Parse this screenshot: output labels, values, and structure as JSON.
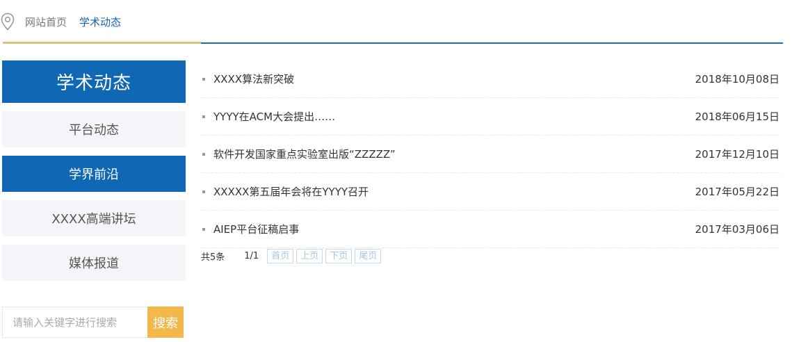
{
  "breadcrumb": {
    "home": "网站首页",
    "current": "学术动态"
  },
  "sidebar": {
    "title": "学术动态",
    "items": [
      {
        "label": "平台动态",
        "active": false
      },
      {
        "label": "学界前沿",
        "active": true
      },
      {
        "label": "XXXX高端讲坛",
        "active": false
      },
      {
        "label": "媒体报道",
        "active": false
      }
    ]
  },
  "search": {
    "placeholder": "请输入关键字进行搜索",
    "button": "搜索"
  },
  "news": [
    {
      "title": "XXXX算法新突破",
      "date": "2018年10月08日"
    },
    {
      "title": "YYYY在ACM大会提出……",
      "date": "2018年06月15日"
    },
    {
      "title": "软件开发国家重点实验室出版“ZZZZZ”",
      "date": "2017年12月10日"
    },
    {
      "title": "XXXXX第五届年会将在YYYY召开",
      "date": "2017年05月22日"
    },
    {
      "title": "AIEP平台征稿启事",
      "date": "2017年03月06日"
    }
  ],
  "pager": {
    "total": "共5条",
    "pages": "1/1",
    "first": "首页",
    "prev": "上页",
    "next": "下页",
    "last": "尾页"
  },
  "colors": {
    "primary": "#1068b5",
    "accent": "#f2b84b",
    "gold_line": "#d8c57a"
  }
}
